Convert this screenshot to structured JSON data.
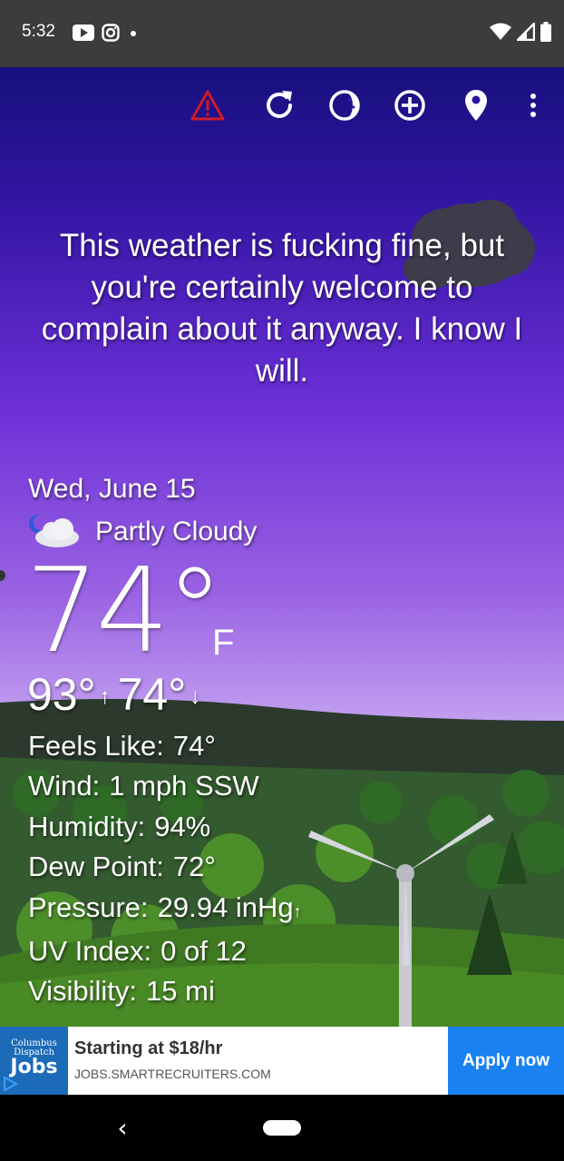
{
  "status_bar": {
    "time": "5:32",
    "left_icons": [
      "youtube-icon",
      "instagram-icon",
      "dot-icon"
    ],
    "right_icons": [
      "wifi-icon",
      "signal-icon",
      "battery-icon"
    ]
  },
  "toolbar": {
    "icons": [
      "alert-icon",
      "refresh-icon",
      "theme-icon",
      "add-location-icon",
      "location-pin-icon",
      "more-options-icon"
    ],
    "alert_color": "#d01a2a"
  },
  "quip": "This weather is fucking fine, but you're certainly welcome to complain about it anyway. I know I will.",
  "weather": {
    "date": "Wed, June 15",
    "condition": "Partly Cloudy",
    "condition_icon": "partly-cloudy-night-icon",
    "temperature": "74°",
    "unit": "F",
    "high": "93°",
    "high_arrow": "↑",
    "low": "74°",
    "low_arrow": "↓"
  },
  "details": {
    "feels_like": {
      "label": "Feels Like:",
      "value": "74°"
    },
    "wind": {
      "label": "Wind:",
      "value": "1 mph SSW"
    },
    "humidity": {
      "label": "Humidity:",
      "value": "94%"
    },
    "dew_point": {
      "label": "Dew Point:",
      "value": "72°"
    },
    "pressure": {
      "label": "Pressure:",
      "value": "29.94 inHg",
      "trend_arrow": "↑"
    },
    "uv_index": {
      "label": "UV Index:",
      "value": "0 of 12"
    },
    "visibility": {
      "label": "Visibility:",
      "value": "15 mi"
    }
  },
  "ad": {
    "logo_line1": "Columbus Dispatch",
    "logo_line2": "Jobs",
    "title": "Starting at $18/hr",
    "url": "JOBS.SMARTRECRUITERS.COM",
    "cta": "Apply now",
    "cta_color": "#1a82f0"
  },
  "nav_bar": {
    "back_glyph": "‹"
  }
}
